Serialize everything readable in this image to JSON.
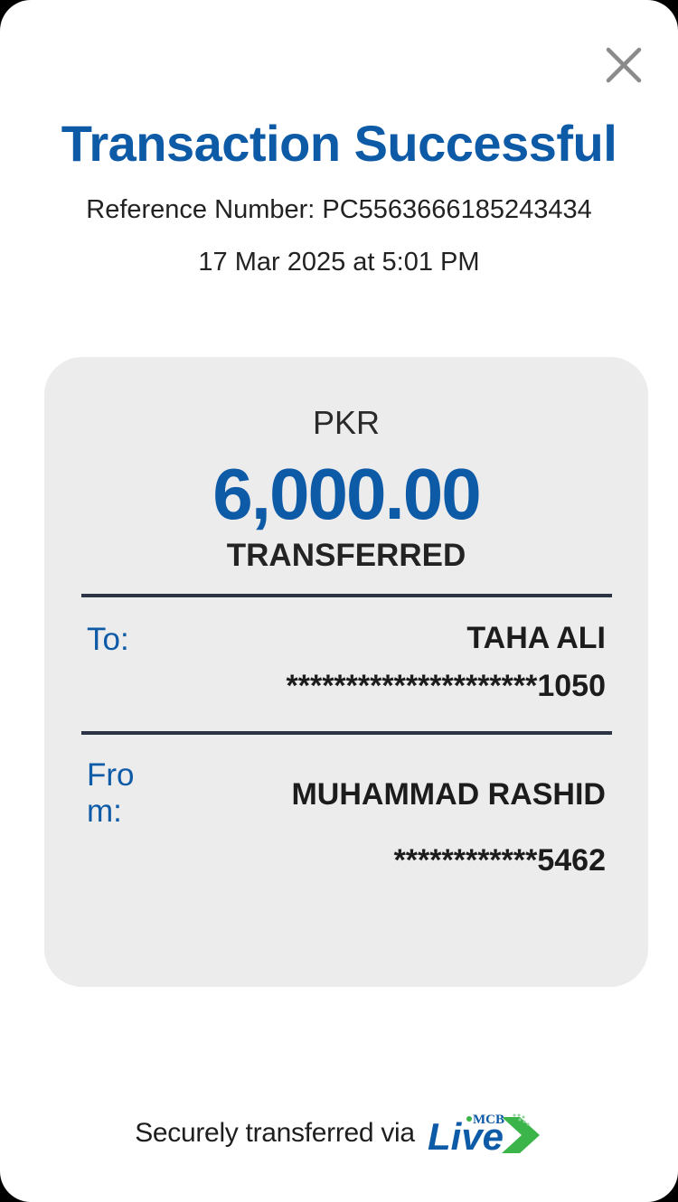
{
  "header": {
    "close_icon": "close-icon",
    "title": "Transaction Successful",
    "reference": "Reference Number: PC5563666185243434",
    "datetime": "17 Mar 2025 at 5:01 PM"
  },
  "receipt": {
    "currency": "PKR",
    "amount": "6,000.00",
    "status": "TRANSFERRED",
    "to": {
      "label": "To:",
      "name": "TAHA ALI",
      "account": "*********************1050"
    },
    "from": {
      "label": "From:",
      "name": "MUHAMMAD RASHID",
      "account": "************5462"
    }
  },
  "footer": {
    "text": "Securely transferred via",
    "logo_text": "Live",
    "logo_brand": "MCB"
  },
  "colors": {
    "primary_blue": "#0d5aa7",
    "card_bg": "#ececed",
    "logo_green": "#3bb54a"
  }
}
